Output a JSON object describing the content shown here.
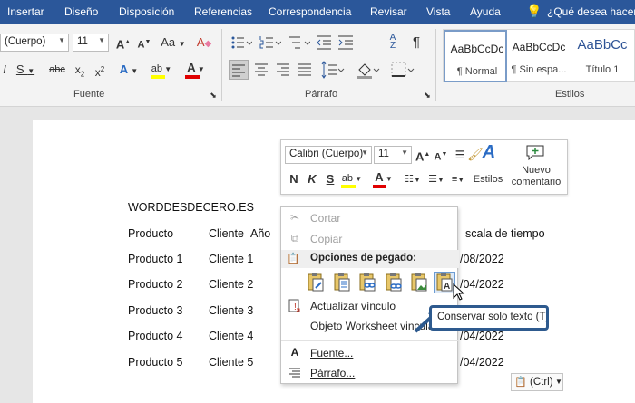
{
  "menu": {
    "tabs": [
      "Insertar",
      "Diseño",
      "Disposición",
      "Referencias",
      "Correspondencia",
      "Revisar",
      "Vista",
      "Ayuda"
    ],
    "tell_me": "¿Qué desea hacer?"
  },
  "ribbon": {
    "font_name": "(Cuerpo)",
    "font_size": "11",
    "change_case": "Aa",
    "group_font": "Fuente",
    "group_paragraph": "Párrafo",
    "group_styles": "Estilos",
    "styles": [
      {
        "sample": "AaBbCcDc",
        "name": "¶ Normal"
      },
      {
        "sample": "AaBbCcDc",
        "name": "¶ Sin espa..."
      },
      {
        "sample": "AaBbCc",
        "name": "Título 1"
      }
    ]
  },
  "document": {
    "title": "WORDDESDECERO.ES",
    "header": {
      "col1": "Producto",
      "col2": "Cliente",
      "col3": "Año",
      "col4": "scala de tiempo"
    },
    "rows": [
      {
        "product": "Producto 1",
        "client": "Cliente 1",
        "date": "/08/2022"
      },
      {
        "product": "Producto 2",
        "client": "Cliente 2",
        "date": "/04/2022"
      },
      {
        "product": "Producto 3",
        "client": "Cliente 3",
        "date": ""
      },
      {
        "product": "Producto 4",
        "client": "Cliente 4",
        "date": "/04/2022"
      },
      {
        "product": "Producto 5",
        "client": "Cliente 5",
        "date": "/04/2022"
      }
    ]
  },
  "mini_toolbar": {
    "font_name": "Calibri (Cuerpo)",
    "font_size": "11",
    "styles_label": "Estilos",
    "new_comment_label_1": "Nuevo",
    "new_comment_label_2": "comentario"
  },
  "context_menu": {
    "cut": "Cortar",
    "copy": "Copiar",
    "paste_options": "Opciones de pegado:",
    "update_link": "Actualizar vínculo",
    "worksheet_object": "Objeto Worksheet vinculado",
    "font": "Fuente...",
    "paragraph": "Párrafo..."
  },
  "tooltip": "Conservar solo texto (T)",
  "paste_ctrl": "(Ctrl)",
  "colors": {
    "accent": "#2b579a",
    "highlight_yellow": "#ffff00",
    "font_red": "#e00000",
    "callout": "#2e5a8e"
  }
}
